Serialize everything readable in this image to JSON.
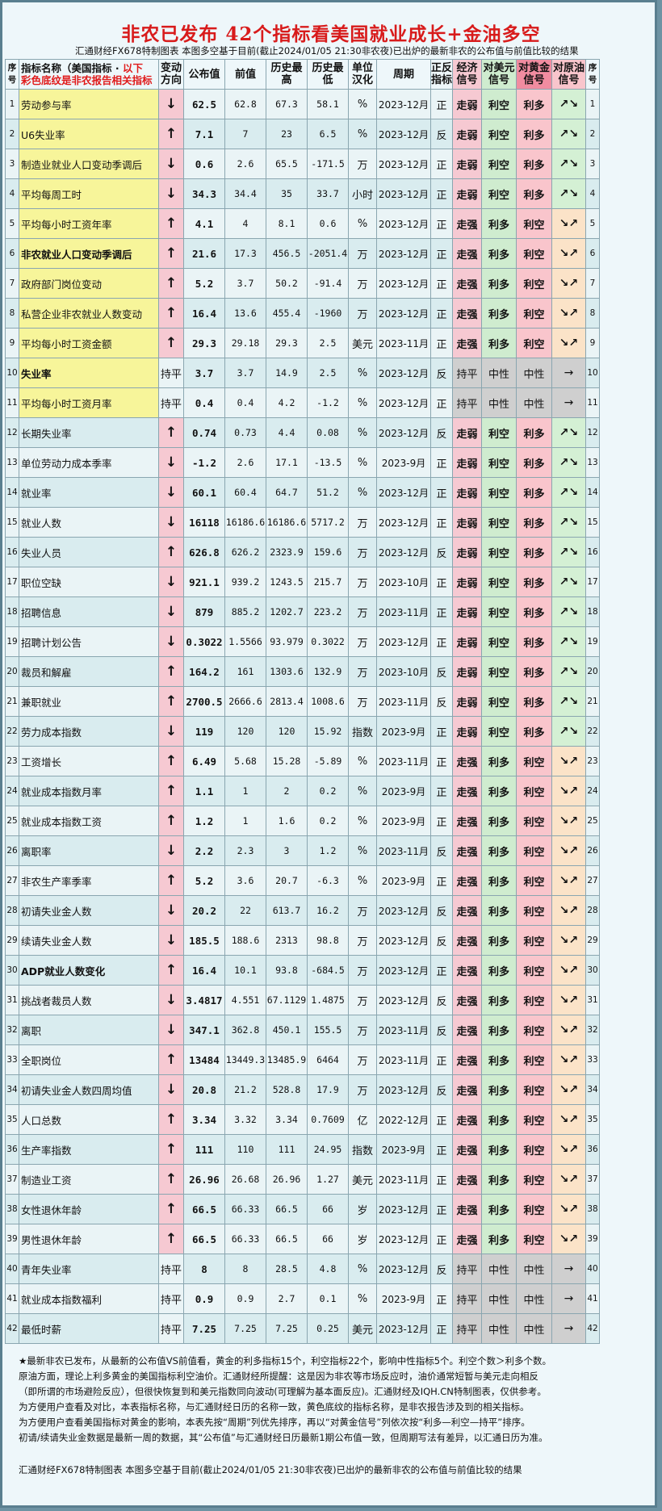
{
  "title": "非农已发布  42个指标看美国就业成长+金油多空",
  "subtitle": "汇通财经FX678特制图表 本图多空基于目前(截止2024/01/05 21:30非农夜)已出炉的最新非农的公布值与前值比较的结果",
  "headers": {
    "idx": "序号",
    "name_main": "指标名称（美国指标 · ",
    "name_red1": "以下",
    "name_red2": "彩色底纹是非农报告相关指标",
    "change": "变动方向",
    "value": "公布值",
    "prev": "前值",
    "high": "历史最高",
    "low": "历史最低",
    "unit": "单位汉化",
    "period": "周期",
    "dir": "正反指标",
    "econ": "经济信号",
    "usd": "对美元信号",
    "gold": "对黄金信号",
    "oil": "对原油信号",
    "idx2": "序号"
  },
  "rows": [
    {
      "idx": "1",
      "name": "劳动参与率",
      "chg": "↓",
      "value": "62.5",
      "prev": "62.8",
      "high": "67.3",
      "low": "58.1",
      "unit": "%",
      "period": "2023-12月",
      "dir": "正",
      "econ": "走弱",
      "usd": "利空",
      "gold": "利多",
      "oil": "↗↘"
    },
    {
      "idx": "2",
      "name": "U6失业率",
      "chg": "↑",
      "value": "7.1",
      "prev": "7",
      "high": "23",
      "low": "6.5",
      "unit": "%",
      "period": "2023-12月",
      "dir": "反",
      "econ": "走弱",
      "usd": "利空",
      "gold": "利多",
      "oil": "↗↘"
    },
    {
      "idx": "3",
      "name": "制造业就业人口变动季调后",
      "chg": "↓",
      "value": "0.6",
      "prev": "2.6",
      "high": "65.5",
      "low": "-171.5",
      "unit": "万",
      "period": "2023-12月",
      "dir": "正",
      "econ": "走弱",
      "usd": "利空",
      "gold": "利多",
      "oil": "↗↘"
    },
    {
      "idx": "4",
      "name": "平均每周工时",
      "chg": "↓",
      "value": "34.3",
      "prev": "34.4",
      "high": "35",
      "low": "33.7",
      "unit": "小时",
      "period": "2023-12月",
      "dir": "正",
      "econ": "走弱",
      "usd": "利空",
      "gold": "利多",
      "oil": "↗↘"
    },
    {
      "idx": "5",
      "name": "平均每小时工资年率",
      "chg": "↑",
      "value": "4.1",
      "prev": "4",
      "high": "8.1",
      "low": "0.6",
      "unit": "%",
      "period": "2023-12月",
      "dir": "正",
      "econ": "走强",
      "usd": "利多",
      "gold": "利空",
      "oil": "↘↗"
    },
    {
      "idx": "6",
      "name": "非农就业人口变动季调后",
      "chg": "↑",
      "value": "21.6",
      "prev": "17.3",
      "high": "456.5",
      "low": "-2051.4",
      "unit": "万",
      "period": "2023-12月",
      "dir": "正",
      "econ": "走强",
      "usd": "利多",
      "gold": "利空",
      "oil": "↘↗"
    },
    {
      "idx": "7",
      "name": "政府部门岗位变动",
      "chg": "↑",
      "value": "5.2",
      "prev": "3.7",
      "high": "50.2",
      "low": "-91.4",
      "unit": "万",
      "period": "2023-12月",
      "dir": "正",
      "econ": "走强",
      "usd": "利多",
      "gold": "利空",
      "oil": "↘↗"
    },
    {
      "idx": "8",
      "name": "私营企业非农就业人数变动",
      "chg": "↑",
      "value": "16.4",
      "prev": "13.6",
      "high": "455.4",
      "low": "-1960",
      "unit": "万",
      "period": "2023-12月",
      "dir": "正",
      "econ": "走强",
      "usd": "利多",
      "gold": "利空",
      "oil": "↘↗"
    },
    {
      "idx": "9",
      "name": "平均每小时工资金额",
      "chg": "↑",
      "value": "29.3",
      "prev": "29.18",
      "high": "29.3",
      "low": "2.5",
      "unit": "美元",
      "period": "2023-11月",
      "dir": "正",
      "econ": "走强",
      "usd": "利多",
      "gold": "利空",
      "oil": "↘↗"
    },
    {
      "idx": "10",
      "name": "失业率",
      "chg": "持平",
      "value": "3.7",
      "prev": "3.7",
      "high": "14.9",
      "low": "2.5",
      "unit": "%",
      "period": "2023-12月",
      "dir": "反",
      "econ": "持平",
      "usd": "中性",
      "gold": "中性",
      "oil": "→"
    },
    {
      "idx": "11",
      "name": "平均每小时工资月率",
      "chg": "持平",
      "value": "0.4",
      "prev": "0.4",
      "high": "4.2",
      "low": "-1.2",
      "unit": "%",
      "period": "2023-12月",
      "dir": "正",
      "econ": "持平",
      "usd": "中性",
      "gold": "中性",
      "oil": "→"
    },
    {
      "idx": "12",
      "name": "长期失业率",
      "chg": "↑",
      "value": "0.74",
      "prev": "0.73",
      "high": "4.4",
      "low": "0.08",
      "unit": "%",
      "period": "2023-12月",
      "dir": "反",
      "econ": "走弱",
      "usd": "利空",
      "gold": "利多",
      "oil": "↗↘"
    },
    {
      "idx": "13",
      "name": "单位劳动力成本季率",
      "chg": "↓",
      "value": "-1.2",
      "prev": "2.6",
      "high": "17.1",
      "low": "-13.5",
      "unit": "%",
      "period": "2023-9月",
      "dir": "正",
      "econ": "走弱",
      "usd": "利空",
      "gold": "利多",
      "oil": "↗↘"
    },
    {
      "idx": "14",
      "name": "就业率",
      "chg": "↓",
      "value": "60.1",
      "prev": "60.4",
      "high": "64.7",
      "low": "51.2",
      "unit": "%",
      "period": "2023-12月",
      "dir": "正",
      "econ": "走弱",
      "usd": "利空",
      "gold": "利多",
      "oil": "↗↘"
    },
    {
      "idx": "15",
      "name": "就业人数",
      "chg": "↓",
      "value": "16118",
      "prev": "16186.6",
      "high": "16186.6",
      "low": "5717.2",
      "unit": "万",
      "period": "2023-12月",
      "dir": "正",
      "econ": "走弱",
      "usd": "利空",
      "gold": "利多",
      "oil": "↗↘"
    },
    {
      "idx": "16",
      "name": "失业人员",
      "chg": "↑",
      "value": "626.8",
      "prev": "626.2",
      "high": "2323.9",
      "low": "159.6",
      "unit": "万",
      "period": "2023-12月",
      "dir": "反",
      "econ": "走弱",
      "usd": "利空",
      "gold": "利多",
      "oil": "↗↘"
    },
    {
      "idx": "17",
      "name": "职位空缺",
      "chg": "↓",
      "value": "921.1",
      "prev": "939.2",
      "high": "1243.5",
      "low": "215.7",
      "unit": "万",
      "period": "2023-10月",
      "dir": "正",
      "econ": "走弱",
      "usd": "利空",
      "gold": "利多",
      "oil": "↗↘"
    },
    {
      "idx": "18",
      "name": "招聘信息",
      "chg": "↓",
      "value": "879",
      "prev": "885.2",
      "high": "1202.7",
      "low": "223.2",
      "unit": "万",
      "period": "2023-11月",
      "dir": "正",
      "econ": "走弱",
      "usd": "利空",
      "gold": "利多",
      "oil": "↗↘"
    },
    {
      "idx": "19",
      "name": "招聘计划公告",
      "chg": "↓",
      "value": "0.3022",
      "prev": "1.5566",
      "high": "93.979",
      "low": "0.3022",
      "unit": "万",
      "period": "2023-12月",
      "dir": "正",
      "econ": "走弱",
      "usd": "利空",
      "gold": "利多",
      "oil": "↗↘"
    },
    {
      "idx": "20",
      "name": "裁员和解雇",
      "chg": "↑",
      "value": "164.2",
      "prev": "161",
      "high": "1303.6",
      "low": "132.9",
      "unit": "万",
      "period": "2023-10月",
      "dir": "反",
      "econ": "走弱",
      "usd": "利空",
      "gold": "利多",
      "oil": "↗↘"
    },
    {
      "idx": "21",
      "name": "兼职就业",
      "chg": "↑",
      "value": "2700.5",
      "prev": "2666.6",
      "high": "2813.4",
      "low": "1008.6",
      "unit": "万",
      "period": "2023-11月",
      "dir": "反",
      "econ": "走弱",
      "usd": "利空",
      "gold": "利多",
      "oil": "↗↘"
    },
    {
      "idx": "22",
      "name": "劳力成本指数",
      "chg": "↓",
      "value": "119",
      "prev": "120",
      "high": "120",
      "low": "15.92",
      "unit": "指数",
      "period": "2023-9月",
      "dir": "正",
      "econ": "走弱",
      "usd": "利空",
      "gold": "利多",
      "oil": "↗↘"
    },
    {
      "idx": "23",
      "name": "工资增长",
      "chg": "↑",
      "value": "6.49",
      "prev": "5.68",
      "high": "15.28",
      "low": "-5.89",
      "unit": "%",
      "period": "2023-11月",
      "dir": "正",
      "econ": "走强",
      "usd": "利多",
      "gold": "利空",
      "oil": "↘↗"
    },
    {
      "idx": "24",
      "name": "就业成本指数月率",
      "chg": "↑",
      "value": "1.1",
      "prev": "1",
      "high": "2",
      "low": "0.2",
      "unit": "%",
      "period": "2023-9月",
      "dir": "正",
      "econ": "走强",
      "usd": "利多",
      "gold": "利空",
      "oil": "↘↗"
    },
    {
      "idx": "25",
      "name": "就业成本指数工资",
      "chg": "↑",
      "value": "1.2",
      "prev": "1",
      "high": "1.6",
      "low": "0.2",
      "unit": "%",
      "period": "2023-9月",
      "dir": "正",
      "econ": "走强",
      "usd": "利多",
      "gold": "利空",
      "oil": "↘↗"
    },
    {
      "idx": "26",
      "name": "离职率",
      "chg": "↓",
      "value": "2.2",
      "prev": "2.3",
      "high": "3",
      "low": "1.2",
      "unit": "%",
      "period": "2023-11月",
      "dir": "反",
      "econ": "走强",
      "usd": "利多",
      "gold": "利空",
      "oil": "↘↗"
    },
    {
      "idx": "27",
      "name": "非农生产率季率",
      "chg": "↑",
      "value": "5.2",
      "prev": "3.6",
      "high": "20.7",
      "low": "-6.3",
      "unit": "%",
      "period": "2023-9月",
      "dir": "正",
      "econ": "走强",
      "usd": "利多",
      "gold": "利空",
      "oil": "↘↗"
    },
    {
      "idx": "28",
      "name": "初请失业金人数",
      "chg": "↓",
      "value": "20.2",
      "prev": "22",
      "high": "613.7",
      "low": "16.2",
      "unit": "万",
      "period": "2023-12月",
      "dir": "反",
      "econ": "走强",
      "usd": "利多",
      "gold": "利空",
      "oil": "↘↗"
    },
    {
      "idx": "29",
      "name": "续请失业金人数",
      "chg": "↓",
      "value": "185.5",
      "prev": "188.6",
      "high": "2313",
      "low": "98.8",
      "unit": "万",
      "period": "2023-12月",
      "dir": "反",
      "econ": "走强",
      "usd": "利多",
      "gold": "利空",
      "oil": "↘↗"
    },
    {
      "idx": "30",
      "name": "ADP就业人数变化",
      "chg": "↑",
      "value": "16.4",
      "prev": "10.1",
      "high": "93.8",
      "low": "-684.5",
      "unit": "万",
      "period": "2023-12月",
      "dir": "正",
      "econ": "走强",
      "usd": "利多",
      "gold": "利空",
      "oil": "↘↗"
    },
    {
      "idx": "31",
      "name": "挑战者裁员人数",
      "chg": "↓",
      "value": "3.4817",
      "prev": "4.551",
      "high": "67.1129",
      "low": "1.4875",
      "unit": "万",
      "period": "2023-12月",
      "dir": "反",
      "econ": "走强",
      "usd": "利多",
      "gold": "利空",
      "oil": "↘↗"
    },
    {
      "idx": "32",
      "name": "离职",
      "chg": "↓",
      "value": "347.1",
      "prev": "362.8",
      "high": "450.1",
      "low": "155.5",
      "unit": "万",
      "period": "2023-11月",
      "dir": "反",
      "econ": "走强",
      "usd": "利多",
      "gold": "利空",
      "oil": "↘↗"
    },
    {
      "idx": "33",
      "name": "全职岗位",
      "chg": "↑",
      "value": "13484",
      "prev": "13449.3",
      "high": "13485.9",
      "low": "6464",
      "unit": "万",
      "period": "2023-11月",
      "dir": "正",
      "econ": "走强",
      "usd": "利多",
      "gold": "利空",
      "oil": "↘↗"
    },
    {
      "idx": "34",
      "name": "初请失业金人数四周均值",
      "chg": "↓",
      "value": "20.8",
      "prev": "21.2",
      "high": "528.8",
      "low": "17.9",
      "unit": "万",
      "period": "2023-12月",
      "dir": "反",
      "econ": "走强",
      "usd": "利多",
      "gold": "利空",
      "oil": "↘↗"
    },
    {
      "idx": "35",
      "name": "人口总数",
      "chg": "↑",
      "value": "3.34",
      "prev": "3.32",
      "high": "3.34",
      "low": "0.7609",
      "unit": "亿",
      "period": "2022-12月",
      "dir": "正",
      "econ": "走强",
      "usd": "利多",
      "gold": "利空",
      "oil": "↘↗"
    },
    {
      "idx": "36",
      "name": "生产率指数",
      "chg": "↑",
      "value": "111",
      "prev": "110",
      "high": "111",
      "low": "24.95",
      "unit": "指数",
      "period": "2023-9月",
      "dir": "正",
      "econ": "走强",
      "usd": "利多",
      "gold": "利空",
      "oil": "↘↗"
    },
    {
      "idx": "37",
      "name": "制造业工资",
      "chg": "↑",
      "value": "26.96",
      "prev": "26.68",
      "high": "26.96",
      "low": "1.27",
      "unit": "美元",
      "period": "2023-11月",
      "dir": "正",
      "econ": "走强",
      "usd": "利多",
      "gold": "利空",
      "oil": "↘↗"
    },
    {
      "idx": "38",
      "name": "女性退休年龄",
      "chg": "↑",
      "value": "66.5",
      "prev": "66.33",
      "high": "66.5",
      "low": "66",
      "unit": "岁",
      "period": "2023-12月",
      "dir": "正",
      "econ": "走强",
      "usd": "利多",
      "gold": "利空",
      "oil": "↘↗"
    },
    {
      "idx": "39",
      "name": "男性退休年龄",
      "chg": "↑",
      "value": "66.5",
      "prev": "66.33",
      "high": "66.5",
      "low": "66",
      "unit": "岁",
      "period": "2023-12月",
      "dir": "正",
      "econ": "走强",
      "usd": "利多",
      "gold": "利空",
      "oil": "↘↗"
    },
    {
      "idx": "40",
      "name": "青年失业率",
      "chg": "持平",
      "value": "8",
      "prev": "8",
      "high": "28.5",
      "low": "4.8",
      "unit": "%",
      "period": "2023-12月",
      "dir": "反",
      "econ": "持平",
      "usd": "中性",
      "gold": "中性",
      "oil": "→"
    },
    {
      "idx": "41",
      "name": "就业成本指数福利",
      "chg": "持平",
      "value": "0.9",
      "prev": "0.9",
      "high": "2.7",
      "low": "0.1",
      "unit": "%",
      "period": "2023-9月",
      "dir": "正",
      "econ": "持平",
      "usd": "中性",
      "gold": "中性",
      "oil": "→"
    },
    {
      "idx": "42",
      "name": "最低时薪",
      "chg": "持平",
      "value": "7.25",
      "prev": "7.25",
      "high": "7.25",
      "low": "0.25",
      "unit": "美元",
      "period": "2023-12月",
      "dir": "正",
      "econ": "持平",
      "usd": "中性",
      "gold": "中性",
      "oil": "→"
    }
  ],
  "notes": [
    "★最新非农已发布，从最新的公布值VS前值看，黄金的利多指标15个，利空指标22个，影响中性指标5个。利空个数＞利多个数。",
    "原油方面，理论上利多黄金的美国指标利空油价。汇通财经所提醒：这是因为非农等市场反应时，油价通常短暂与美元走向相反",
    "（即所谓的市场避险反应），但很快恢复到和美元指数同向波动(可理解为基本面反应)。汇通财经及IQH.CN特制图表，仅供参考。",
    "为方便用户查看及对比，本表指标名称，与汇通财经日历的名称一致，黄色底纹的指标名称，是非农报告涉及到的相关指标。",
    "为方便用户查看美国指标对黄金的影响，本表先按“周期”列优先排序，再以“对黄金信号”列依次按“利多—利空—持平”排序。",
    "初请/续请失业金数据是最新一周的数据，其“公布值”与汇通财经日历最新1期公布值一致，但周期写法有差异，以汇通日历为准。"
  ],
  "footer": "汇通财经FX678特制图表 本图多空基于目前(截止2024/01/05 21:30非农夜)已出炉的最新非农的公布值与前值比较的结果"
}
